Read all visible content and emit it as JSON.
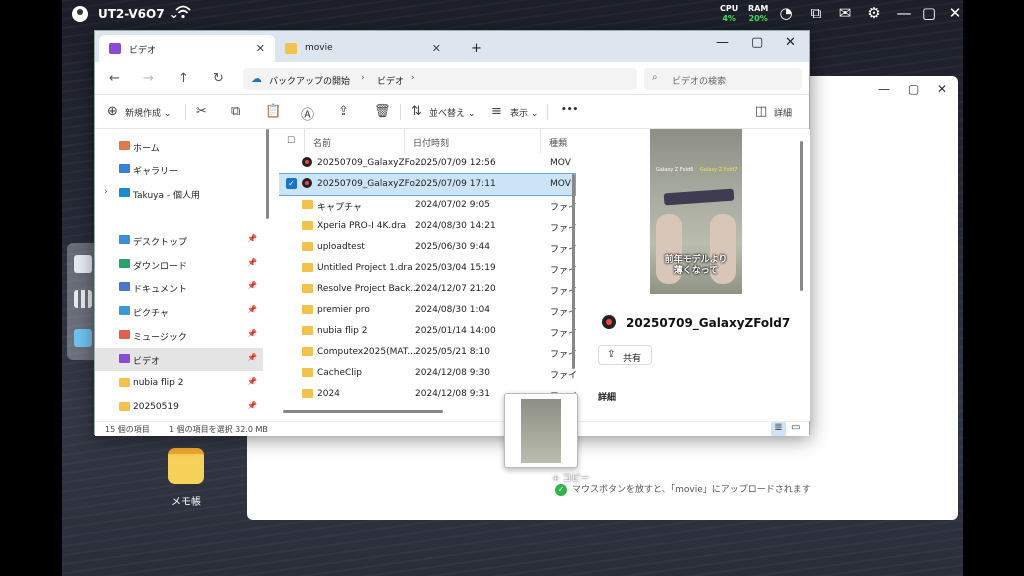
{
  "topbar": {
    "device_name": "UT2-V6O7",
    "cpu_label": "CPU",
    "cpu_value": "4%",
    "ram_label": "RAM",
    "ram_value": "20%"
  },
  "back_window": {
    "drop_message": "マウスボタンを放すと、「movie」にアップロードされます"
  },
  "desktop": {
    "icon_label": "メモ帳"
  },
  "explorer": {
    "tabs": [
      {
        "label": "ビデオ",
        "active": true
      },
      {
        "label": "movie",
        "active": false
      }
    ],
    "breadcrumb": [
      "バックアップの開始",
      "ビデオ"
    ],
    "search_placeholder": "ビデオの検索",
    "toolbar": {
      "new": "新規作成",
      "sort": "並べ替え",
      "view": "表示",
      "more": "•••",
      "details": "詳細"
    },
    "nav": [
      {
        "label": "ホーム",
        "color": "#e07a4a",
        "pinned": false
      },
      {
        "label": "ギャラリー",
        "color": "#3b82d6",
        "pinned": false
      },
      {
        "label": "Takuya - 個人用",
        "color": "#1b8ad3",
        "pinned": false
      },
      {
        "label": "デスクトップ",
        "color": "#3b8fd6",
        "pinned": true
      },
      {
        "label": "ダウンロード",
        "color": "#2aa36b",
        "pinned": true
      },
      {
        "label": "ドキュメント",
        "color": "#4a78c8",
        "pinned": true
      },
      {
        "label": "ピクチャ",
        "color": "#3b9ad6",
        "pinned": true
      },
      {
        "label": "ミュージック",
        "color": "#e0604a",
        "pinned": true
      },
      {
        "label": "ビデオ",
        "color": "#8b4ad6",
        "pinned": true,
        "selected": true
      },
      {
        "label": "nubia flip 2",
        "color": "#f2c14e",
        "pinned": true
      },
      {
        "label": "20250519",
        "color": "#f2c14e",
        "pinned": true
      }
    ],
    "columns": {
      "name": "名前",
      "date": "日付時刻",
      "type": "種類"
    },
    "files": [
      {
        "name": "20250709_GalaxyZFo...",
        "date": "2025/07/09 12:56",
        "type": "MOV",
        "kind": "video"
      },
      {
        "name": "20250709_GalaxyZFo...",
        "date": "2025/07/09 17:11",
        "type": "MOV",
        "kind": "video",
        "selected": true
      },
      {
        "name": "キャプチャ",
        "date": "2024/07/02 9:05",
        "type": "ファイ",
        "kind": "folder"
      },
      {
        "name": "Xperia PRO-I 4K.dra",
        "date": "2024/08/30 14:21",
        "type": "ファイ",
        "kind": "folder"
      },
      {
        "name": "uploadtest",
        "date": "2025/06/30 9:44",
        "type": "ファイ",
        "kind": "folder"
      },
      {
        "name": "Untitled Project 1.dra",
        "date": "2025/03/04 15:19",
        "type": "ファイ",
        "kind": "folder"
      },
      {
        "name": "Resolve Project Back...",
        "date": "2024/12/07 21:20",
        "type": "ファイ",
        "kind": "folder"
      },
      {
        "name": "premier pro",
        "date": "2024/08/30 1:04",
        "type": "ファイ",
        "kind": "folder"
      },
      {
        "name": "nubia flip 2",
        "date": "2025/01/14 14:00",
        "type": "ファイ",
        "kind": "folder"
      },
      {
        "name": "Computex2025(MAT...",
        "date": "2025/05/21 8:10",
        "type": "ファイ",
        "kind": "folder"
      },
      {
        "name": "CacheClip",
        "date": "2024/12/08 9:30",
        "type": "ファイ",
        "kind": "folder"
      },
      {
        "name": "2024",
        "date": "2024/12/08 9:31",
        "type": "ファイ",
        "kind": "folder"
      }
    ],
    "preview": {
      "title": "20250709_GalaxyZFold7",
      "share": "共有",
      "details_heading": "詳細",
      "thumb_text_left": "Galaxy Z Fold6",
      "thumb_text_right": "Galaxy Z Fold7",
      "thumb_caption_1": "前年モデルより",
      "thumb_caption_2": "薄くなって"
    },
    "status": {
      "count": "15 個の項目",
      "selection": "1 個の項目を選択 32.0 MB"
    }
  },
  "drag": {
    "copy_label": "+ コピー"
  }
}
